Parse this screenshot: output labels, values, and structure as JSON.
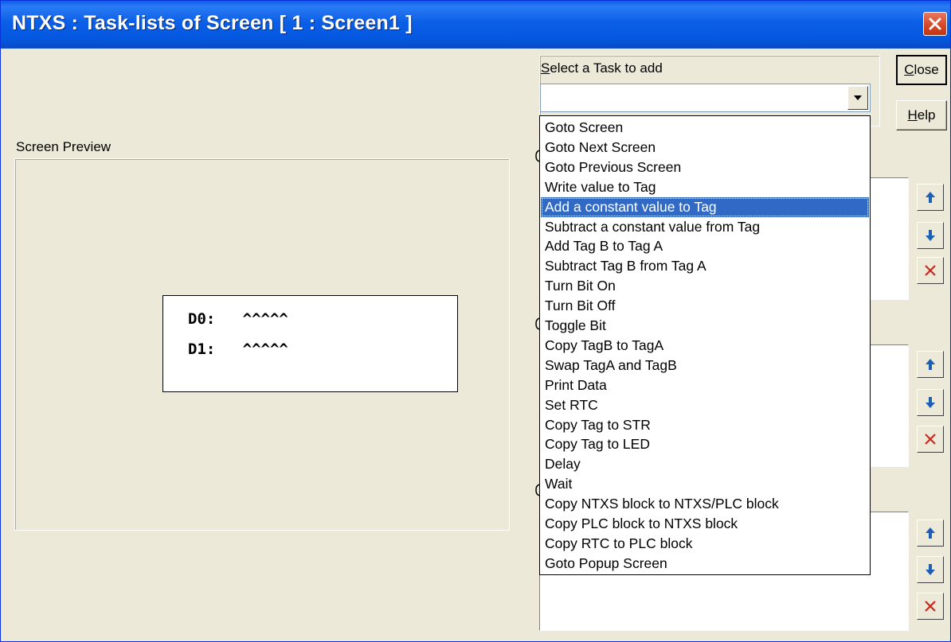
{
  "window": {
    "title": "NTXS : Task-lists of Screen [ 1 : Screen1 ]"
  },
  "preview": {
    "label": "Screen Preview",
    "lcd_rows": [
      "D0:   ^^^^^",
      "D1:   ^^^^^"
    ]
  },
  "task_select": {
    "label_prefix": "S",
    "label_rest": "elect a Task to add",
    "value": ""
  },
  "buttons": {
    "close_mnemonic": "C",
    "close_rest": "lose",
    "help_mnemonic": "H",
    "help_rest": "elp"
  },
  "dropdown": {
    "selected_index": 4,
    "items": [
      "Goto Screen",
      "Goto Next Screen",
      "Goto Previous Screen",
      "Write value to Tag",
      "Add a constant value to Tag",
      "Subtract a constant value from Tag",
      "Add Tag B to Tag A",
      "Subtract Tag B from Tag A",
      "Turn Bit On",
      "Turn Bit Off",
      "Toggle Bit",
      "Copy TagB to TagA",
      "Swap TagA and TagB",
      "Print Data",
      "Set RTC",
      "Copy Tag to STR",
      "Copy Tag to LED",
      "Delay",
      "Wait",
      "Copy NTXS block to NTXS/PLC block",
      "Copy PLC block to NTXS block",
      "Copy RTC to PLC block",
      "Goto Popup Screen"
    ]
  },
  "icons": {
    "move_up": "arrow-up-icon",
    "move_down": "arrow-down-icon",
    "delete": "delete-x-icon",
    "window_close": "close-icon"
  },
  "colors": {
    "title_bar": "#0b5fe6",
    "selection": "#316ac5",
    "arrow": "#1c5fb5",
    "delete": "#c8281e"
  }
}
